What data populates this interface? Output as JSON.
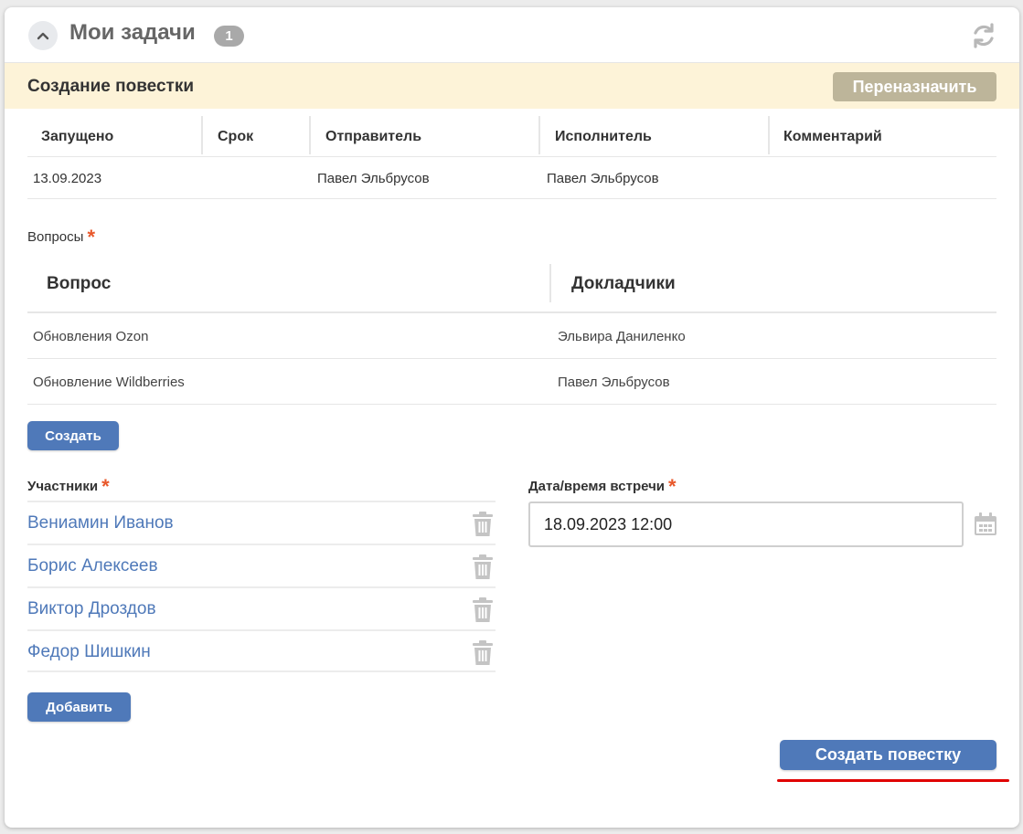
{
  "header": {
    "title": "Мои задачи",
    "count": "1",
    "collapse_icon": "chevron-up-icon",
    "refresh_icon": "refresh-icon"
  },
  "task": {
    "title": "Создание повестки",
    "reassign_label": "Переназначить"
  },
  "info_table": {
    "columns": [
      "Запущено",
      "Срок",
      "Отправитель",
      "Исполнитель",
      "Комментарий"
    ],
    "row": [
      "13.09.2023",
      "",
      "Павел Эльбрусов",
      "Павел Эльбрусов",
      ""
    ]
  },
  "questions": {
    "label": "Вопросы",
    "required": "*",
    "columns": [
      "Вопрос",
      "Докладчики"
    ],
    "rows": [
      [
        "Обновления Ozon",
        "Эльвира Даниленко"
      ],
      [
        "Обновление Wildberries",
        "Павел Эльбрусов"
      ]
    ],
    "create_label": "Создать"
  },
  "participants": {
    "label": "Участники",
    "required": "*",
    "items": [
      "Вениамин Иванов",
      "Борис Алексеев",
      "Виктор Дроздов",
      "Федор Шишкин"
    ],
    "add_label": "Добавить"
  },
  "meeting": {
    "label": "Дата/время встречи",
    "required": "*",
    "value": "18.09.2023 12:00"
  },
  "submit_label": "Создать повестку",
  "colors": {
    "accent": "#4f79b9",
    "task_bar": "#fdf3d8",
    "reassign": "#bdb59a",
    "required": "#e8582b",
    "annotation_underline": "#e00000"
  }
}
